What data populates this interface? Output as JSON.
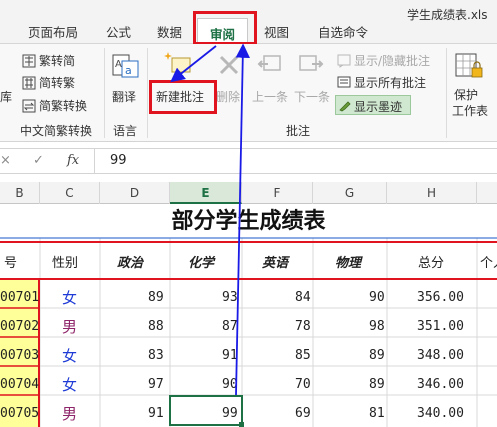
{
  "window": {
    "title": "学生成绩表.xls"
  },
  "tabs": {
    "page_layout": "页面布局",
    "formulas": "公式",
    "data": "数据",
    "review": "审阅",
    "view": "视图",
    "custom": "自选命令"
  },
  "ribbon": {
    "left_cut_label": "库",
    "convert": {
      "to_simplified": "繁转简",
      "to_traditional": "简转繁",
      "convert": "简繁转换",
      "group_label": "中文简繁转换"
    },
    "language": {
      "translate": "翻译",
      "group_label": "语言"
    },
    "comments": {
      "new_comment": "新建批注",
      "delete": "删除",
      "previous": "上一条",
      "next": "下一条",
      "show_hide": "显示/隐藏批注",
      "show_all": "显示所有批注",
      "show_ink": "显示墨迹",
      "group_label": "批注"
    },
    "protect": {
      "label_line1": "保护",
      "label_line2": "工作表"
    }
  },
  "formula_bar": {
    "cancel_icon": "×",
    "confirm_icon": "✓",
    "fx_label": "fx",
    "value": "99"
  },
  "sheet": {
    "columns": [
      "B",
      "C",
      "D",
      "E",
      "F",
      "G",
      "H"
    ],
    "selected_column": "E",
    "title": "部分学生成绩表",
    "headers": {
      "id": "号",
      "gender": "性别",
      "politics": "政治",
      "chemistry": "化学",
      "english": "英语",
      "physics": "物理",
      "total": "总分",
      "rank": "个人"
    },
    "rows": [
      {
        "id": "00701",
        "gender": "女",
        "politics": "89",
        "chemistry": "93",
        "english": "84",
        "physics": "90",
        "total": "356.00"
      },
      {
        "id": "00702",
        "gender": "男",
        "politics": "88",
        "chemistry": "87",
        "english": "78",
        "physics": "98",
        "total": "351.00"
      },
      {
        "id": "00703",
        "gender": "女",
        "politics": "83",
        "chemistry": "91",
        "english": "85",
        "physics": "89",
        "total": "348.00"
      },
      {
        "id": "00704",
        "gender": "女",
        "politics": "97",
        "chemistry": "90",
        "english": "70",
        "physics": "89",
        "total": "346.00"
      },
      {
        "id": "00705",
        "gender": "男",
        "politics": "91",
        "chemistry": "99",
        "english": "69",
        "physics": "81",
        "total": "340.00"
      }
    ]
  },
  "colors": {
    "accent_green": "#1e7145",
    "highlight_red": "#e0141e",
    "annotation_blue": "#1a1ae6",
    "id_cell_yellow": "#ffff99",
    "female_blue": "#1f3bd6",
    "male_purple": "#8e2469"
  }
}
